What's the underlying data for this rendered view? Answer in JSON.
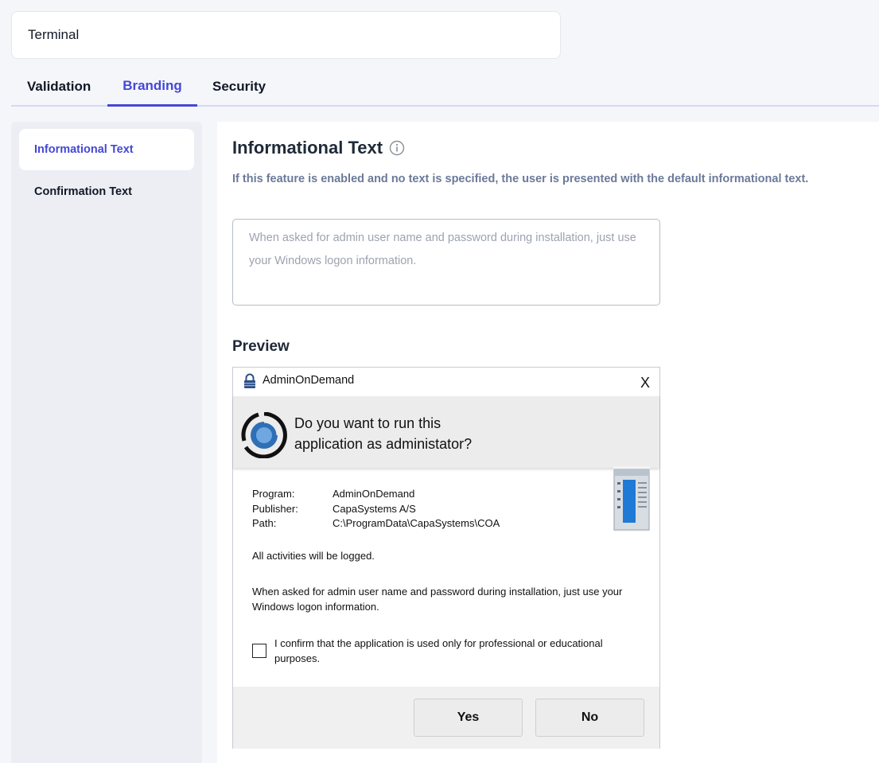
{
  "name_field": {
    "value": "Terminal"
  },
  "tabs": [
    {
      "label": "Validation"
    },
    {
      "label": "Branding",
      "active": true
    },
    {
      "label": "Security"
    }
  ],
  "sidebar": {
    "items": [
      {
        "label": "Informational Text",
        "active": true
      },
      {
        "label": "Confirmation Text"
      }
    ]
  },
  "main": {
    "title": "Informational Text",
    "title_icon": "info-icon",
    "description": "If this feature is enabled and no text is specified, the user is presented with the default informational text.",
    "textarea_placeholder": "When asked for admin user name and password during installation, just use your Windows logon information.",
    "preview_label": "Preview"
  },
  "dialog": {
    "title": "AdminOnDemand",
    "close_label": "X",
    "question_line1": "Do you want to run this",
    "question_line2": "application as administator?",
    "info": [
      {
        "key": "Program:",
        "value": "AdminOnDemand"
      },
      {
        "key": "Publisher:",
        "value": "CapaSystems A/S"
      },
      {
        "key": "Path:",
        "value": "C:\\ProgramData\\CapaSystems\\COA"
      }
    ],
    "logged_text": "All activities will be logged.",
    "info_text": "When asked for admin user name and password during installation, just use your Windows logon information.",
    "confirm_text": "I confirm that the application is used only for professional or educational purposes.",
    "yes_label": "Yes",
    "no_label": "No"
  },
  "colors": {
    "accent": "#4547d6",
    "page_bg": "#f5f6fa",
    "sidebar_bg": "#eceef3",
    "description": "#6b7a99"
  }
}
